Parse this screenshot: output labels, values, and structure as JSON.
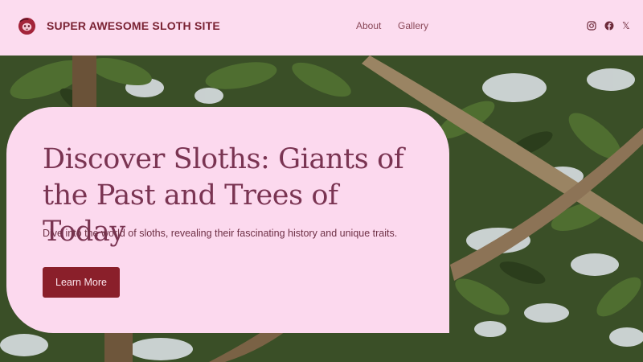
{
  "header": {
    "site_title": "SUPER AWESOME SLOTH SITE",
    "logo_icon": "sloth-logo-icon",
    "nav": [
      {
        "label": "About"
      },
      {
        "label": "Gallery"
      }
    ],
    "social": [
      {
        "icon": "instagram-icon"
      },
      {
        "icon": "facebook-icon"
      },
      {
        "icon": "x-icon",
        "glyph": "𝕏"
      }
    ]
  },
  "hero": {
    "headline": "Discover Sloths: Giants of the Past and Trees of Today",
    "subtitle": "Dive into the world of sloths, revealing their fascinating history and unique traits.",
    "cta_label": "Learn More",
    "background": "forest-canopy-photo"
  },
  "colors": {
    "header_bg": "#fcdcef",
    "card_bg": "#fcd9ee",
    "accent": "#8a1f2a",
    "headline": "#7a3452"
  }
}
